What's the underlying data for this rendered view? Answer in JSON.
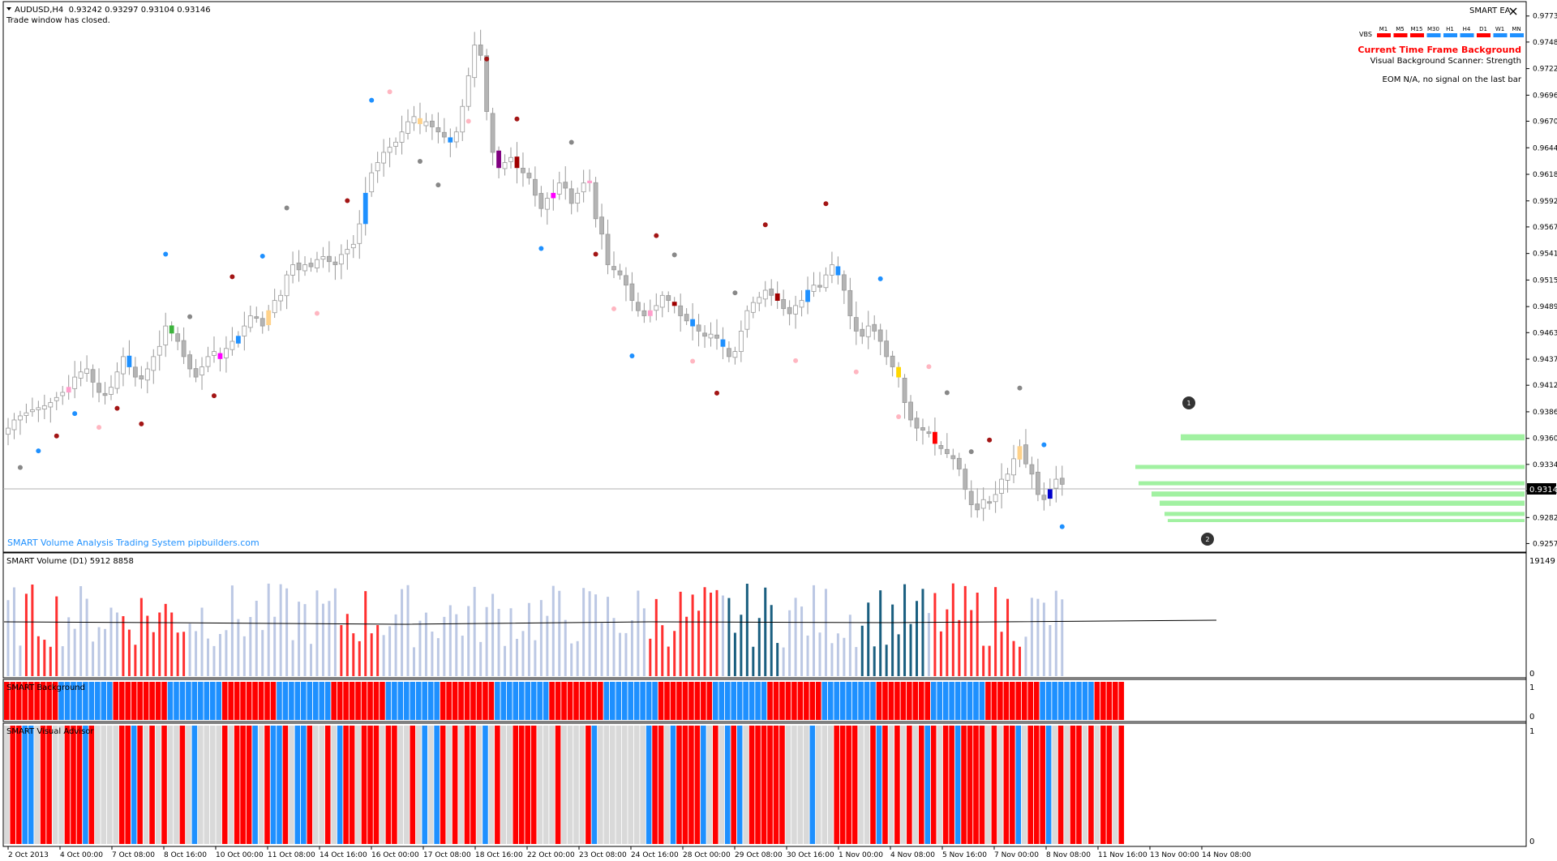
{
  "header": {
    "symbol_line": "AUDUSD,H4  0.93242 0.93297 0.93104 0.93146",
    "status": "Trade window has closed.",
    "watermark": "SMART Volume Analysis Trading System pipbuilders.com"
  },
  "ea_panel": {
    "title": "SMART EA",
    "row_label": "VBS",
    "timeframes": [
      {
        "label": "M1",
        "color": "#ff0000"
      },
      {
        "label": "M5",
        "color": "#ff0000"
      },
      {
        "label": "M15",
        "color": "#ff0000"
      },
      {
        "label": "M30",
        "color": "#1e90ff"
      },
      {
        "label": "H1",
        "color": "#1e90ff"
      },
      {
        "label": "H4",
        "color": "#1e90ff"
      },
      {
        "label": "D1",
        "color": "#ff0000"
      },
      {
        "label": "W1",
        "color": "#1e90ff"
      },
      {
        "label": "MN",
        "color": "#1e90ff"
      }
    ],
    "heading": "Current Time Frame Background",
    "heading_color": "#ff0000",
    "sub": "Visual Background Scanner: Strength",
    "eom": "EOM N/A, no signal on the last bar"
  },
  "markers": [
    "1",
    "2"
  ],
  "subwindows": {
    "volume_label": "SMART Volume (D1) 5912 8858",
    "volume_max": "19149",
    "volume_min": "0",
    "background_label": "SMART Background",
    "background_max": "1",
    "background_min": "0",
    "advisor_label": "SMART Visual Advisor",
    "advisor_max": "1",
    "advisor_min": "0"
  },
  "colors": {
    "bg_red": "#ff0000",
    "bg_blue": "#1e90ff",
    "bull": "#ffffff",
    "bear": "#b4b4b4",
    "zone": "#90ee90",
    "vol_red": "#ff3030",
    "vol_blue": "#bcc8e4",
    "vol_teal": "#1a5f80",
    "advisor_grey": "#d9d9d9"
  },
  "chart_data": {
    "type": "candlestick",
    "symbol": "AUDUSD",
    "timeframe": "H4",
    "current_price": "0.93146",
    "ohlc": {
      "open": 0.93242,
      "high": 0.93297,
      "low": 0.93104,
      "close": 0.93146
    },
    "price_axis_labels": [
      "0.97735",
      "0.97480",
      "0.97220",
      "0.96960",
      "0.96705",
      "0.96445",
      "0.96185",
      "0.95925",
      "0.95670",
      "0.95410",
      "0.95150",
      "0.94890",
      "0.94635",
      "0.94375",
      "0.94120",
      "0.93860",
      "0.93600",
      "0.93345",
      "0.93085",
      "0.92825",
      "0.92570"
    ],
    "price_axis_values": [
      0.97735,
      0.9748,
      0.9722,
      0.9696,
      0.96705,
      0.96445,
      0.96185,
      0.95925,
      0.9567,
      0.9541,
      0.9515,
      0.9489,
      0.94635,
      0.94375,
      0.9412,
      0.9386,
      0.936,
      0.93345,
      0.93085,
      0.92825,
      0.9257
    ],
    "time_axis_labels": [
      "2 Oct 2013",
      "4 Oct 00:00",
      "7 Oct 08:00",
      "8 Oct 16:00",
      "10 Oct 00:00",
      "11 Oct 08:00",
      "14 Oct 16:00",
      "16 Oct 00:00",
      "17 Oct 08:00",
      "18 Oct 16:00",
      "22 Oct 00:00",
      "23 Oct 08:00",
      "24 Oct 16:00",
      "28 Oct 00:00",
      "29 Oct 08:00",
      "30 Oct 16:00",
      "1 Nov 00:00",
      "4 Nov 08:00",
      "5 Nov 16:00",
      "7 Nov 00:00",
      "8 Nov 08:00",
      "11 Nov 16:00",
      "13 Nov 00:00",
      "14 Nov 08:00"
    ],
    "ylim": [
      0.9251,
      0.9786
    ],
    "bars_close": [
      0.937,
      0.9378,
      0.9382,
      0.9385,
      0.9388,
      0.939,
      0.9392,
      0.9395,
      0.94,
      0.9405,
      0.941,
      0.942,
      0.9425,
      0.9428,
      0.9415,
      0.9405,
      0.9402,
      0.941,
      0.9425,
      0.944,
      0.943,
      0.942,
      0.9418,
      0.9428,
      0.944,
      0.945,
      0.947,
      0.9463,
      0.9455,
      0.944,
      0.9428,
      0.942,
      0.943,
      0.944,
      0.9445,
      0.9438,
      0.9448,
      0.9455,
      0.946,
      0.947,
      0.948,
      0.9478,
      0.947,
      0.9485,
      0.9495,
      0.95,
      0.952,
      0.953,
      0.9525,
      0.953,
      0.9528,
      0.9535,
      0.9538,
      0.9533,
      0.953,
      0.954,
      0.9545,
      0.955,
      0.957,
      0.96,
      0.962,
      0.963,
      0.964,
      0.9645,
      0.965,
      0.966,
      0.967,
      0.9675,
      0.9668,
      0.967,
      0.9665,
      0.966,
      0.9655,
      0.965,
      0.966,
      0.9685,
      0.9715,
      0.9745,
      0.9735,
      0.968,
      0.964,
      0.9625,
      0.963,
      0.9635,
      0.9625,
      0.962,
      0.9615,
      0.9598,
      0.9585,
      0.9595,
      0.96,
      0.961,
      0.9605,
      0.959,
      0.96,
      0.961,
      0.9612,
      0.9575,
      0.956,
      0.953,
      0.9525,
      0.952,
      0.951,
      0.9495,
      0.9485,
      0.948,
      0.9485,
      0.949,
      0.95,
      0.9495,
      0.949,
      0.948,
      0.9475,
      0.947,
      0.9465,
      0.946,
      0.9462,
      0.9458,
      0.945,
      0.944,
      0.9445,
      0.9465,
      0.9485,
      0.9493,
      0.9498,
      0.9505,
      0.95,
      0.9495,
      0.9487,
      0.9482,
      0.949,
      0.9495,
      0.9505,
      0.951,
      0.9508,
      0.952,
      0.953,
      0.952,
      0.9505,
      0.948,
      0.9465,
      0.946,
      0.947,
      0.9465,
      0.9455,
      0.944,
      0.943,
      0.942,
      0.9395,
      0.9378,
      0.937,
      0.9368,
      0.9365,
      0.9355,
      0.935,
      0.9345,
      0.934,
      0.933,
      0.931,
      0.9295,
      0.929,
      0.93,
      0.9298,
      0.9305,
      0.932,
      0.9325,
      0.934,
      0.9352,
      0.9335,
      0.9325,
      0.9305,
      0.93,
      0.931,
      0.932,
      0.9315
    ]
  }
}
